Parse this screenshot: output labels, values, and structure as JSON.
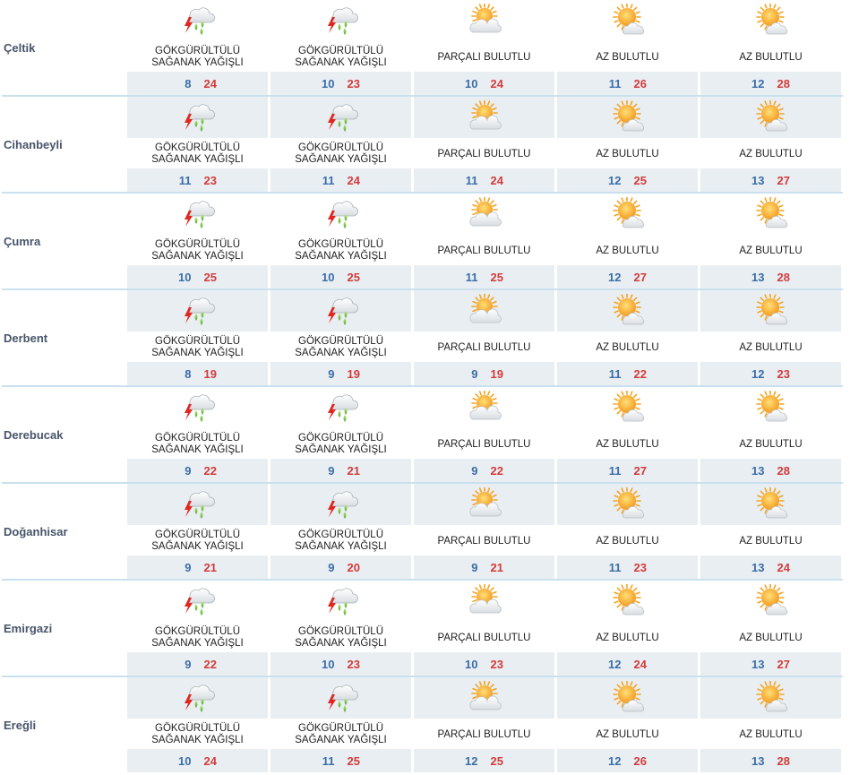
{
  "icons": {
    "storm": "thunderstorm-rain-icon",
    "partly": "partly-cloudy-icon",
    "few": "mostly-sunny-icon"
  },
  "colors": {
    "min_temp": "#3a6ea8",
    "max_temp": "#d23c3c",
    "row_shade": "#e9eef2",
    "separator": "#c9e1ee"
  },
  "rows": [
    {
      "city": "Çeltik",
      "days": [
        {
          "icon": "storm",
          "desc": [
            "GÖKGÜRÜLTÜLÜ",
            "SAĞANAK YAĞIŞLI"
          ],
          "min": "8",
          "max": "24"
        },
        {
          "icon": "storm",
          "desc": [
            "GÖKGÜRÜLTÜLÜ",
            "SAĞANAK YAĞIŞLI"
          ],
          "min": "10",
          "max": "23"
        },
        {
          "icon": "partly",
          "desc": [
            "PARÇALI BULUTLU"
          ],
          "min": "10",
          "max": "24"
        },
        {
          "icon": "few",
          "desc": [
            "AZ BULUTLU"
          ],
          "min": "11",
          "max": "26"
        },
        {
          "icon": "few",
          "desc": [
            "AZ BULUTLU"
          ],
          "min": "12",
          "max": "28"
        }
      ]
    },
    {
      "city": "Cihanbeyli",
      "days": [
        {
          "icon": "storm",
          "desc": [
            "GÖKGÜRÜLTÜLÜ",
            "SAĞANAK YAĞIŞLI"
          ],
          "min": "11",
          "max": "23"
        },
        {
          "icon": "storm",
          "desc": [
            "GÖKGÜRÜLTÜLÜ",
            "SAĞANAK YAĞIŞLI"
          ],
          "min": "11",
          "max": "24"
        },
        {
          "icon": "partly",
          "desc": [
            "PARÇALI BULUTLU"
          ],
          "min": "11",
          "max": "24"
        },
        {
          "icon": "few",
          "desc": [
            "AZ BULUTLU"
          ],
          "min": "12",
          "max": "25"
        },
        {
          "icon": "few",
          "desc": [
            "AZ BULUTLU"
          ],
          "min": "13",
          "max": "27"
        }
      ]
    },
    {
      "city": "Çumra",
      "days": [
        {
          "icon": "storm",
          "desc": [
            "GÖKGÜRÜLTÜLÜ",
            "SAĞANAK YAĞIŞLI"
          ],
          "min": "10",
          "max": "25"
        },
        {
          "icon": "storm",
          "desc": [
            "GÖKGÜRÜLTÜLÜ",
            "SAĞANAK YAĞIŞLI"
          ],
          "min": "10",
          "max": "25"
        },
        {
          "icon": "partly",
          "desc": [
            "PARÇALI BULUTLU"
          ],
          "min": "11",
          "max": "25"
        },
        {
          "icon": "few",
          "desc": [
            "AZ BULUTLU"
          ],
          "min": "12",
          "max": "27"
        },
        {
          "icon": "few",
          "desc": [
            "AZ BULUTLU"
          ],
          "min": "13",
          "max": "28"
        }
      ]
    },
    {
      "city": "Derbent",
      "days": [
        {
          "icon": "storm",
          "desc": [
            "GÖKGÜRÜLTÜLÜ",
            "SAĞANAK YAĞIŞLI"
          ],
          "min": "8",
          "max": "19"
        },
        {
          "icon": "storm",
          "desc": [
            "GÖKGÜRÜLTÜLÜ",
            "SAĞANAK YAĞIŞLI"
          ],
          "min": "9",
          "max": "19"
        },
        {
          "icon": "partly",
          "desc": [
            "PARÇALI BULUTLU"
          ],
          "min": "9",
          "max": "19"
        },
        {
          "icon": "few",
          "desc": [
            "AZ BULUTLU"
          ],
          "min": "11",
          "max": "22"
        },
        {
          "icon": "few",
          "desc": [
            "AZ BULUTLU"
          ],
          "min": "12",
          "max": "23"
        }
      ]
    },
    {
      "city": "Derebucak",
      "days": [
        {
          "icon": "storm",
          "desc": [
            "GÖKGÜRÜLTÜLÜ",
            "SAĞANAK YAĞIŞLI"
          ],
          "min": "9",
          "max": "22"
        },
        {
          "icon": "storm",
          "desc": [
            "GÖKGÜRÜLTÜLÜ",
            "SAĞANAK YAĞIŞLI"
          ],
          "min": "9",
          "max": "21"
        },
        {
          "icon": "partly",
          "desc": [
            "PARÇALI BULUTLU"
          ],
          "min": "9",
          "max": "22"
        },
        {
          "icon": "few",
          "desc": [
            "AZ BULUTLU"
          ],
          "min": "11",
          "max": "27"
        },
        {
          "icon": "few",
          "desc": [
            "AZ BULUTLU"
          ],
          "min": "13",
          "max": "28"
        }
      ]
    },
    {
      "city": "Doğanhisar",
      "days": [
        {
          "icon": "storm",
          "desc": [
            "GÖKGÜRÜLTÜLÜ",
            "SAĞANAK YAĞIŞLI"
          ],
          "min": "9",
          "max": "21"
        },
        {
          "icon": "storm",
          "desc": [
            "GÖKGÜRÜLTÜLÜ",
            "SAĞANAK YAĞIŞLI"
          ],
          "min": "9",
          "max": "20"
        },
        {
          "icon": "partly",
          "desc": [
            "PARÇALI BULUTLU"
          ],
          "min": "9",
          "max": "21"
        },
        {
          "icon": "few",
          "desc": [
            "AZ BULUTLU"
          ],
          "min": "11",
          "max": "23"
        },
        {
          "icon": "few",
          "desc": [
            "AZ BULUTLU"
          ],
          "min": "13",
          "max": "24"
        }
      ]
    },
    {
      "city": "Emirgazi",
      "days": [
        {
          "icon": "storm",
          "desc": [
            "GÖKGÜRÜLTÜLÜ",
            "SAĞANAK YAĞIŞLI"
          ],
          "min": "9",
          "max": "22"
        },
        {
          "icon": "storm",
          "desc": [
            "GÖKGÜRÜLTÜLÜ",
            "SAĞANAK YAĞIŞLI"
          ],
          "min": "10",
          "max": "23"
        },
        {
          "icon": "partly",
          "desc": [
            "PARÇALI BULUTLU"
          ],
          "min": "10",
          "max": "23"
        },
        {
          "icon": "few",
          "desc": [
            "AZ BULUTLU"
          ],
          "min": "12",
          "max": "24"
        },
        {
          "icon": "few",
          "desc": [
            "AZ BULUTLU"
          ],
          "min": "13",
          "max": "27"
        }
      ]
    },
    {
      "city": "Ereğli",
      "days": [
        {
          "icon": "storm",
          "desc": [
            "GÖKGÜRÜLTÜLÜ",
            "SAĞANAK YAĞIŞLI"
          ],
          "min": "10",
          "max": "24"
        },
        {
          "icon": "storm",
          "desc": [
            "GÖKGÜRÜLTÜLÜ",
            "SAĞANAK YAĞIŞLI"
          ],
          "min": "11",
          "max": "25"
        },
        {
          "icon": "partly",
          "desc": [
            "PARÇALI BULUTLU"
          ],
          "min": "12",
          "max": "25"
        },
        {
          "icon": "few",
          "desc": [
            "AZ BULUTLU"
          ],
          "min": "12",
          "max": "26"
        },
        {
          "icon": "few",
          "desc": [
            "AZ BULUTLU"
          ],
          "min": "13",
          "max": "28"
        }
      ]
    }
  ]
}
